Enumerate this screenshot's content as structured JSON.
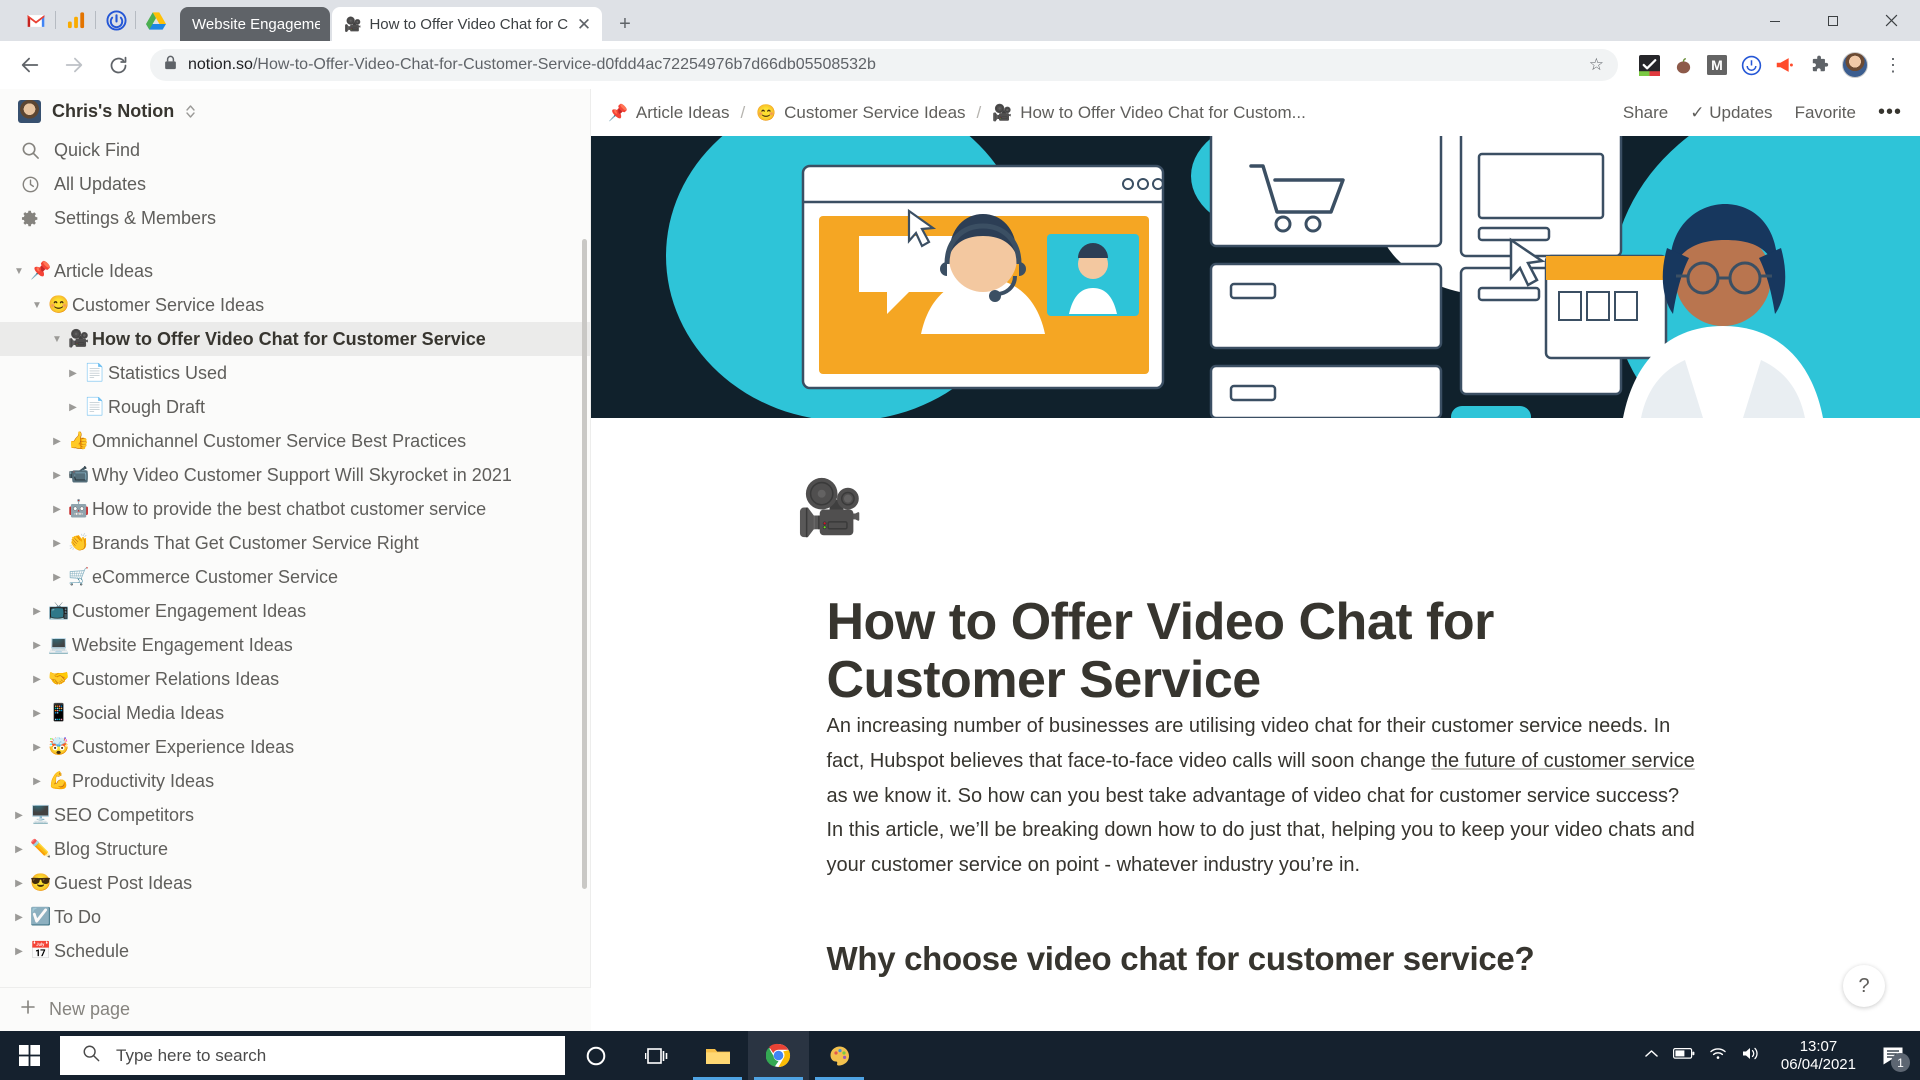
{
  "browser": {
    "pinned_apps": [
      "gmail-icon",
      "analytics-icon",
      "app-icon",
      "drive-icon"
    ],
    "tabs": [
      {
        "title": "Website Engagement",
        "favicon": "",
        "active": false
      },
      {
        "title": "How to Offer Video Chat for Cus",
        "favicon": "🎥",
        "active": true
      }
    ],
    "new_tab_label": "+",
    "window_controls": {
      "minimize": "—",
      "maximize": "▢",
      "close": "✕"
    },
    "nav": {
      "back": "←",
      "forward": "→",
      "reload": "⟳"
    },
    "url": {
      "lock": "lock-icon",
      "domain": "notion.so",
      "path": "/How-to-Offer-Video-Chat-for-Customer-Service-d0fdd4ac72254976b7d66db05508532b"
    },
    "bookmark_star": "☆",
    "extensions": [
      "todoist-icon",
      "apple-icon",
      "mailtrack-icon",
      "smile-circle-icon",
      "megaphone-icon",
      "puzzle-icon"
    ],
    "profile": "avatar",
    "menu": "⋮"
  },
  "sidebar": {
    "workspace": "Chris's Notion",
    "nav": [
      {
        "label": "Quick Find",
        "icon": "search-icon"
      },
      {
        "label": "All Updates",
        "icon": "clock-icon"
      },
      {
        "label": "Settings & Members",
        "icon": "gear-icon"
      }
    ],
    "tree": [
      {
        "label": "Article Ideas",
        "emoji": "📌",
        "depth": 0,
        "arrow": "▼",
        "selected": false
      },
      {
        "label": "Customer Service Ideas",
        "emoji": "😊",
        "depth": 1,
        "arrow": "▼",
        "selected": false
      },
      {
        "label": "How to Offer Video Chat for Customer Service",
        "emoji": "🎥",
        "depth": 2,
        "arrow": "▼",
        "selected": true
      },
      {
        "label": "Statistics Used",
        "emoji": "📄",
        "depth": 3,
        "arrow": "▶",
        "selected": false
      },
      {
        "label": "Rough Draft",
        "emoji": "📄",
        "depth": 3,
        "arrow": "▶",
        "selected": false
      },
      {
        "label": "Omnichannel Customer Service Best Practices",
        "emoji": "👍",
        "depth": 2,
        "arrow": "▶",
        "selected": false
      },
      {
        "label": "Why Video Customer Support Will Skyrocket in 2021",
        "emoji": "📹",
        "depth": 2,
        "arrow": "▶",
        "selected": false
      },
      {
        "label": "How to provide the best chatbot customer service",
        "emoji": "🤖",
        "depth": 2,
        "arrow": "▶",
        "selected": false
      },
      {
        "label": "Brands That Get Customer Service Right",
        "emoji": "👏",
        "depth": 2,
        "arrow": "▶",
        "selected": false
      },
      {
        "label": "eCommerce Customer Service",
        "emoji": "🛒",
        "depth": 2,
        "arrow": "▶",
        "selected": false
      },
      {
        "label": "Customer Engagement Ideas",
        "emoji": "📺",
        "depth": 1,
        "arrow": "▶",
        "selected": false
      },
      {
        "label": "Website Engagement Ideas",
        "emoji": "💻",
        "depth": 1,
        "arrow": "▶",
        "selected": false
      },
      {
        "label": "Customer Relations Ideas",
        "emoji": "🤝",
        "depth": 1,
        "arrow": "▶",
        "selected": false
      },
      {
        "label": "Social Media Ideas",
        "emoji": "📱",
        "depth": 1,
        "arrow": "▶",
        "selected": false
      },
      {
        "label": "Customer Experience Ideas",
        "emoji": "🤯",
        "depth": 1,
        "arrow": "▶",
        "selected": false
      },
      {
        "label": "Productivity Ideas",
        "emoji": "💪",
        "depth": 1,
        "arrow": "▶",
        "selected": false
      },
      {
        "label": "SEO Competitors",
        "emoji": "🖥️",
        "depth": 0,
        "arrow": "▶",
        "selected": false
      },
      {
        "label": "Blog Structure",
        "emoji": "✏️",
        "depth": 0,
        "arrow": "▶",
        "selected": false
      },
      {
        "label": "Guest Post Ideas",
        "emoji": "😎",
        "depth": 0,
        "arrow": "▶",
        "selected": false
      },
      {
        "label": "To Do",
        "emoji": "☑️",
        "depth": 0,
        "arrow": "▶",
        "selected": false
      },
      {
        "label": "Schedule",
        "emoji": "📅",
        "depth": 0,
        "arrow": "▶",
        "selected": false
      }
    ],
    "new_page": "New page"
  },
  "topbar": {
    "breadcrumbs": [
      {
        "label": "Article Ideas",
        "emoji": "📌"
      },
      {
        "label": "Customer Service Ideas",
        "emoji": "😊"
      },
      {
        "label": "How to Offer Video Chat for Custom...",
        "emoji": "🎥"
      }
    ],
    "separator": "/",
    "share": "Share",
    "updates": "Updates",
    "updates_check": "✓",
    "favorite": "Favorite",
    "more": "•••"
  },
  "page": {
    "cover_icon": "🎥",
    "title": "How to Offer Video Chat for Customer Service",
    "paragraph_1_before": "An increasing number of businesses are utilising video chat for their customer service needs. In fact, Hubspot believes that face-to-face video calls will soon change ",
    "paragraph_1_link": "the future of customer service",
    "paragraph_1_after": " as we know it. So how can you best take advantage of video chat for customer service success?",
    "paragraph_2": "In this article, we’ll be breaking down how to do just that, helping you to keep your video chats and your customer service on point - whatever industry you’re in.",
    "heading_2": "Why choose video chat for customer service?",
    "help_button": "?"
  },
  "taskbar": {
    "search_placeholder": "Type here to search",
    "items": [
      "cortana-icon",
      "task-view-icon",
      "file-explorer-icon",
      "chrome-icon",
      "paint-icon"
    ],
    "tray": [
      "chevron-up-icon",
      "battery-icon",
      "wifi-icon",
      "volume-icon"
    ],
    "time": "13:07",
    "date": "06/04/2021",
    "notification_count": "1"
  },
  "colors": {
    "chrome_tabstrip": "#dee1e6",
    "notion_sidebar": "#fbfbfa",
    "selected_row": "#ebebea",
    "taskbar": "#15212e",
    "text_primary": "#37352f",
    "text_secondary": "#5f5e5b",
    "cover_teal": "#2ec4d8",
    "cover_orange": "#f5a623",
    "cover_dark": "#0f2430"
  }
}
